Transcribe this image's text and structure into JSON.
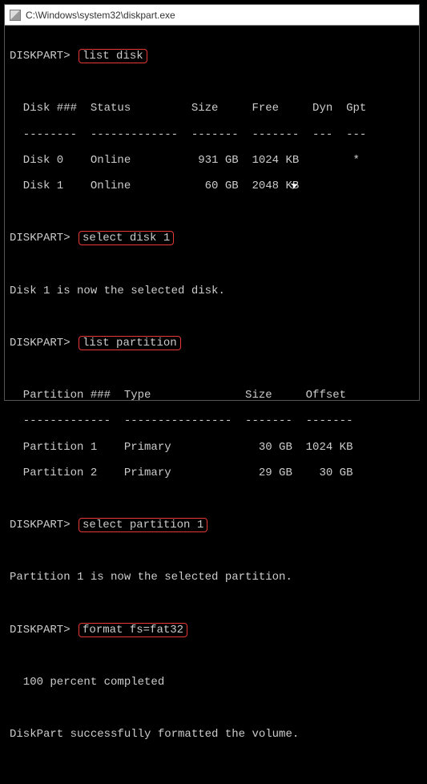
{
  "window": {
    "title": "C:\\Windows\\system32\\diskpart.exe"
  },
  "terminal": {
    "prompt": "DISKPART>",
    "cmd_list_disk": "list disk",
    "disk_header": "  Disk ###  Status         Size     Free     Dyn  Gpt",
    "disk_sep": "  --------  -------------  -------  -------  ---  ---",
    "disk_row0": "  Disk 0    Online          931 GB  1024 KB        *",
    "disk_row1": "  Disk 1    Online           60 GB  2048 KB",
    "cmd_select_disk": "select disk 1",
    "msg_disk_selected": "Disk 1 is now the selected disk.",
    "cmd_list_partition": "list partition",
    "part_header": "  Partition ###  Type              Size     Offset",
    "part_sep": "  -------------  ----------------  -------  -------",
    "part_row0": "  Partition 1    Primary             30 GB  1024 KB",
    "part_row1": "  Partition 2    Primary             29 GB    30 GB",
    "cmd_select_partition": "select partition 1",
    "msg_partition_selected": "Partition 1 is now the selected partition.",
    "cmd_format": "format fs=fat32",
    "msg_progress": "  100 percent completed",
    "msg_success": "DiskPart successfully formatted the volume."
  }
}
